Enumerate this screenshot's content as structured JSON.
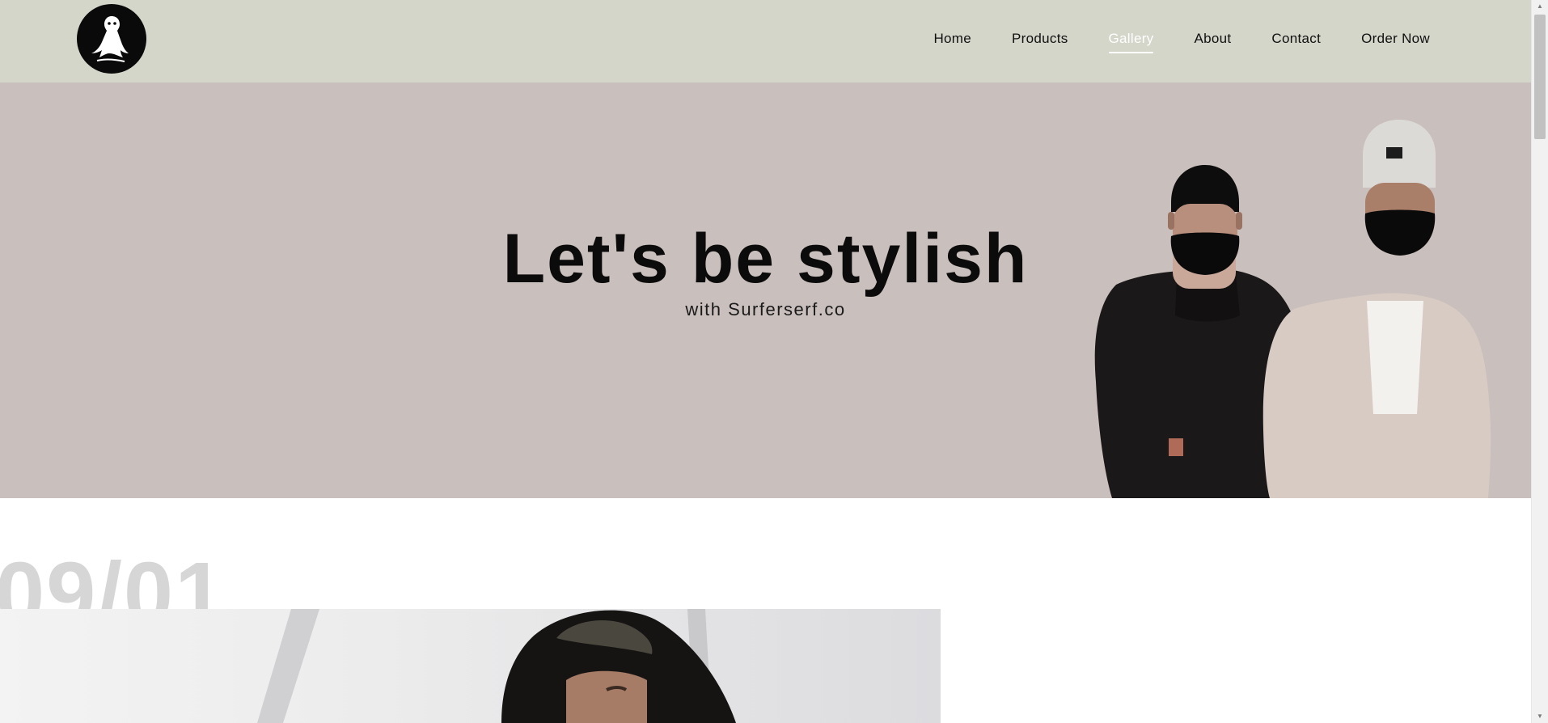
{
  "navbar": {
    "logo_icon": "ghost-logo-icon",
    "items": [
      {
        "label": "Home",
        "active": false
      },
      {
        "label": "Products",
        "active": false
      },
      {
        "label": "Gallery",
        "active": true
      },
      {
        "label": "About",
        "active": false
      },
      {
        "label": "Contact",
        "active": false
      },
      {
        "label": "Order Now",
        "active": false
      }
    ]
  },
  "hero": {
    "title": "Let's be stylish",
    "subtitle": "with Surferserf.co",
    "background": "#c9bfbd"
  },
  "gallery": {
    "date": "09/01"
  },
  "colors": {
    "nav_bg": "#d3d6c9",
    "nav_active": "#ffffff",
    "text": "#0b0b0b",
    "date_text": "#d6d6d6"
  }
}
